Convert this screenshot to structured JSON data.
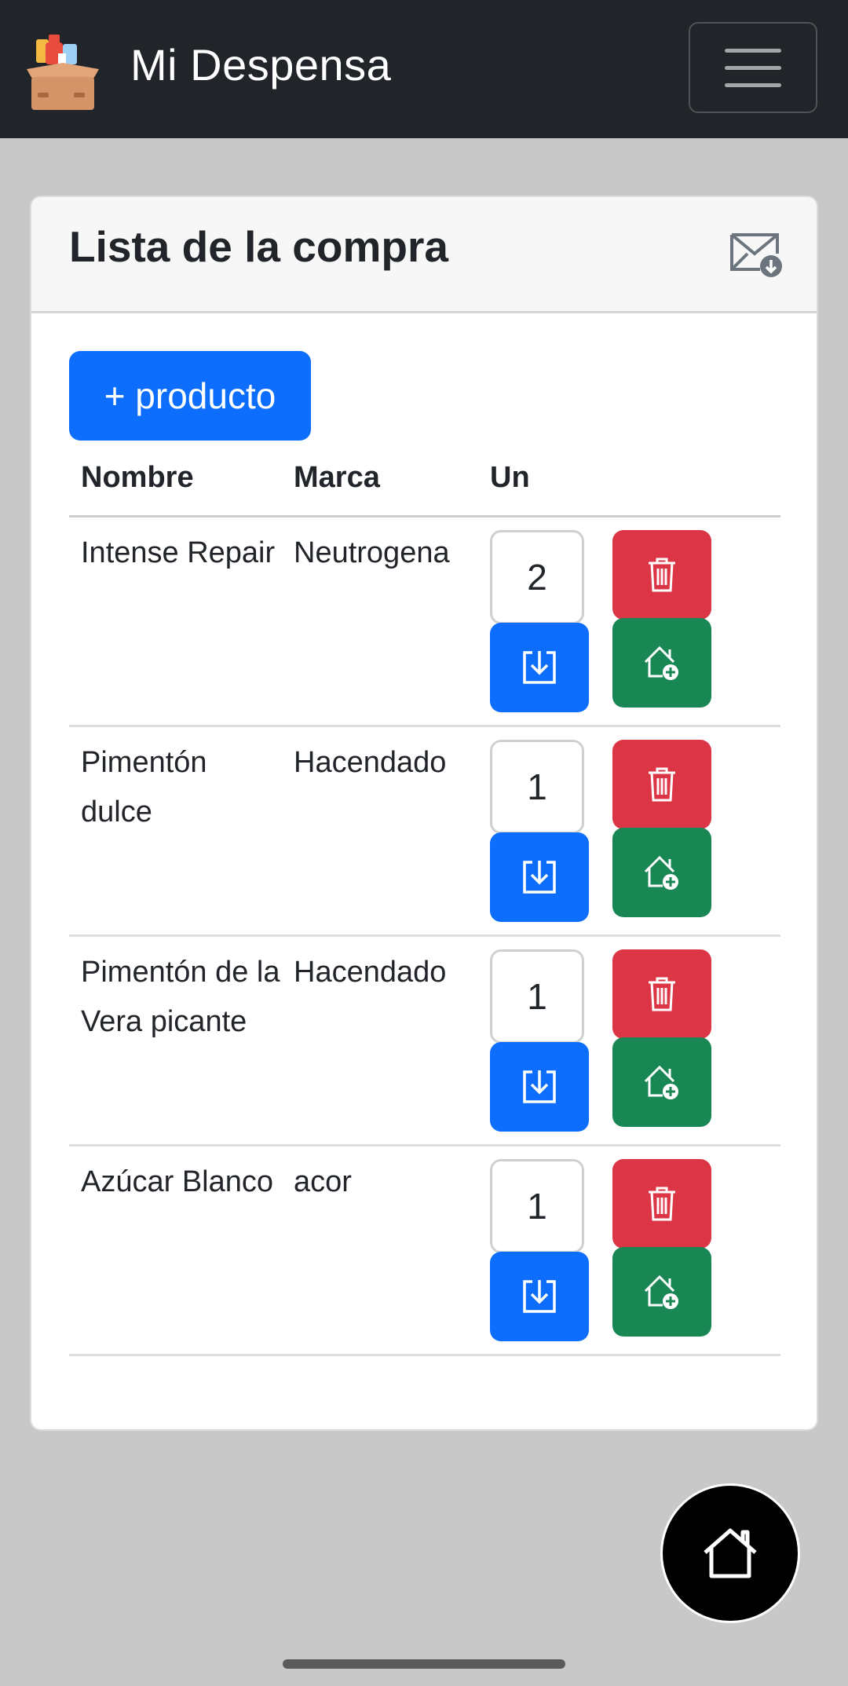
{
  "app": {
    "title": "Mi Despensa",
    "menu_icon": "hamburger-menu-icon",
    "logo_icon": "pantry-box-icon"
  },
  "card": {
    "title": "Lista de la compra",
    "export_icon": "mail-download-icon",
    "add_button": "+ producto"
  },
  "table": {
    "headers": [
      "Nombre",
      "Marca",
      "Un"
    ],
    "rows": [
      {
        "name": "Intense Repair",
        "brand": "Neutrogena",
        "qty": "2"
      },
      {
        "name": "Pimentón dulce",
        "brand": "Hacendado",
        "qty": "1"
      },
      {
        "name": "Pimentón de la Vera picante",
        "brand": "Hacendado",
        "qty": "1"
      },
      {
        "name": "Azúcar Blanco",
        "brand": "acor",
        "qty": "1"
      }
    ]
  },
  "colors": {
    "navbar": "#212529",
    "primary": "#0d6efd",
    "danger": "#dc3545",
    "success": "#198754",
    "background": "#c8c8c8"
  },
  "fab_icon": "home-icon"
}
